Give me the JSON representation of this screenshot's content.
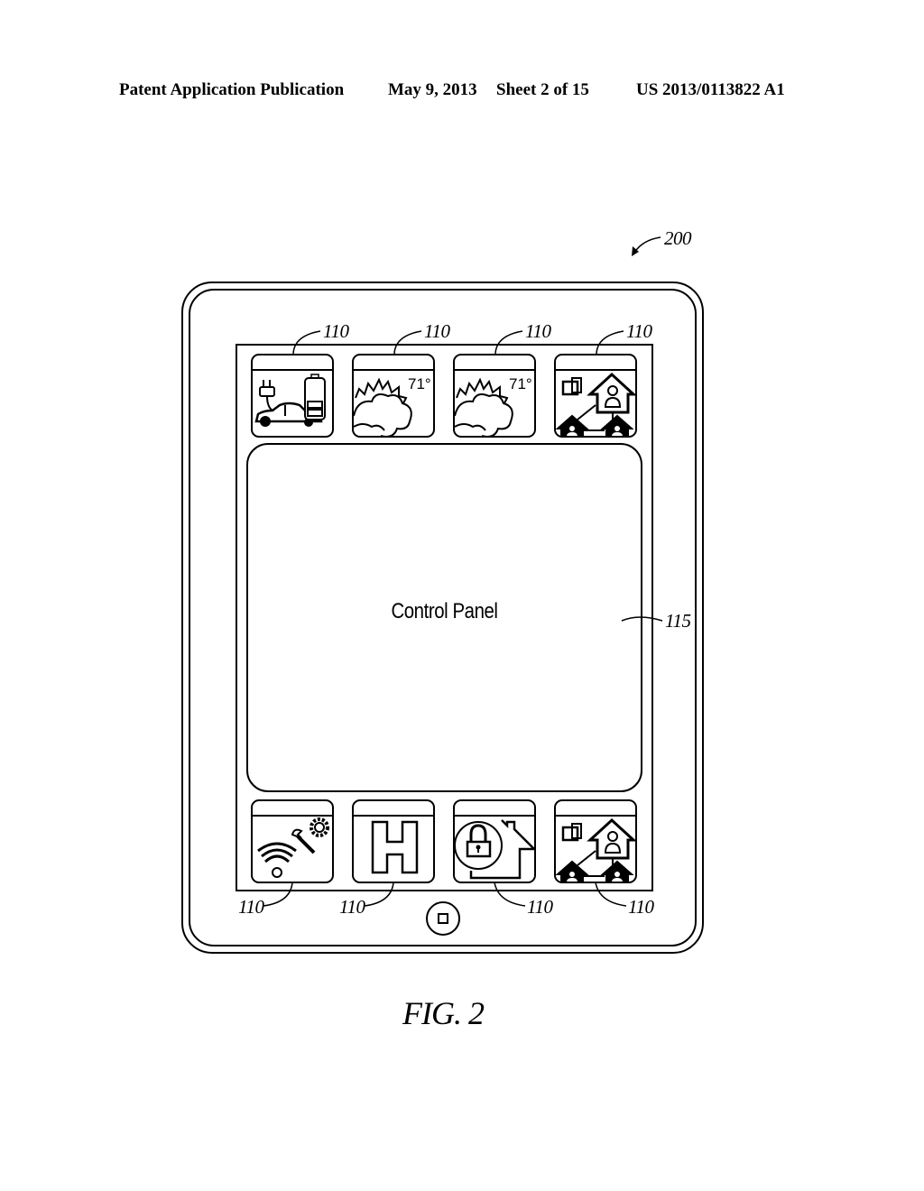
{
  "header": {
    "publication": "Patent Application Publication",
    "date": "May 9, 2013",
    "sheet": "Sheet 2 of 15",
    "number": "US 2013/0113822 A1"
  },
  "figure": {
    "label": "FIG. 2",
    "device_ref": "200",
    "panel_ref": "115",
    "panel_label": "Control Panel"
  },
  "tiles": {
    "top": [
      {
        "ref": "110",
        "icon": "ev-charging-icon"
      },
      {
        "ref": "110",
        "icon": "weather-icon",
        "temperature": "71°"
      },
      {
        "ref": "110",
        "icon": "weather-icon",
        "temperature": "71°"
      },
      {
        "ref": "110",
        "icon": "home-network-icon"
      }
    ],
    "bottom": [
      {
        "ref": "110",
        "icon": "wifi-settings-icon"
      },
      {
        "ref": "110",
        "icon": "hospital-icon"
      },
      {
        "ref": "110",
        "icon": "home-security-icon"
      },
      {
        "ref": "110",
        "icon": "home-network-icon"
      }
    ]
  }
}
